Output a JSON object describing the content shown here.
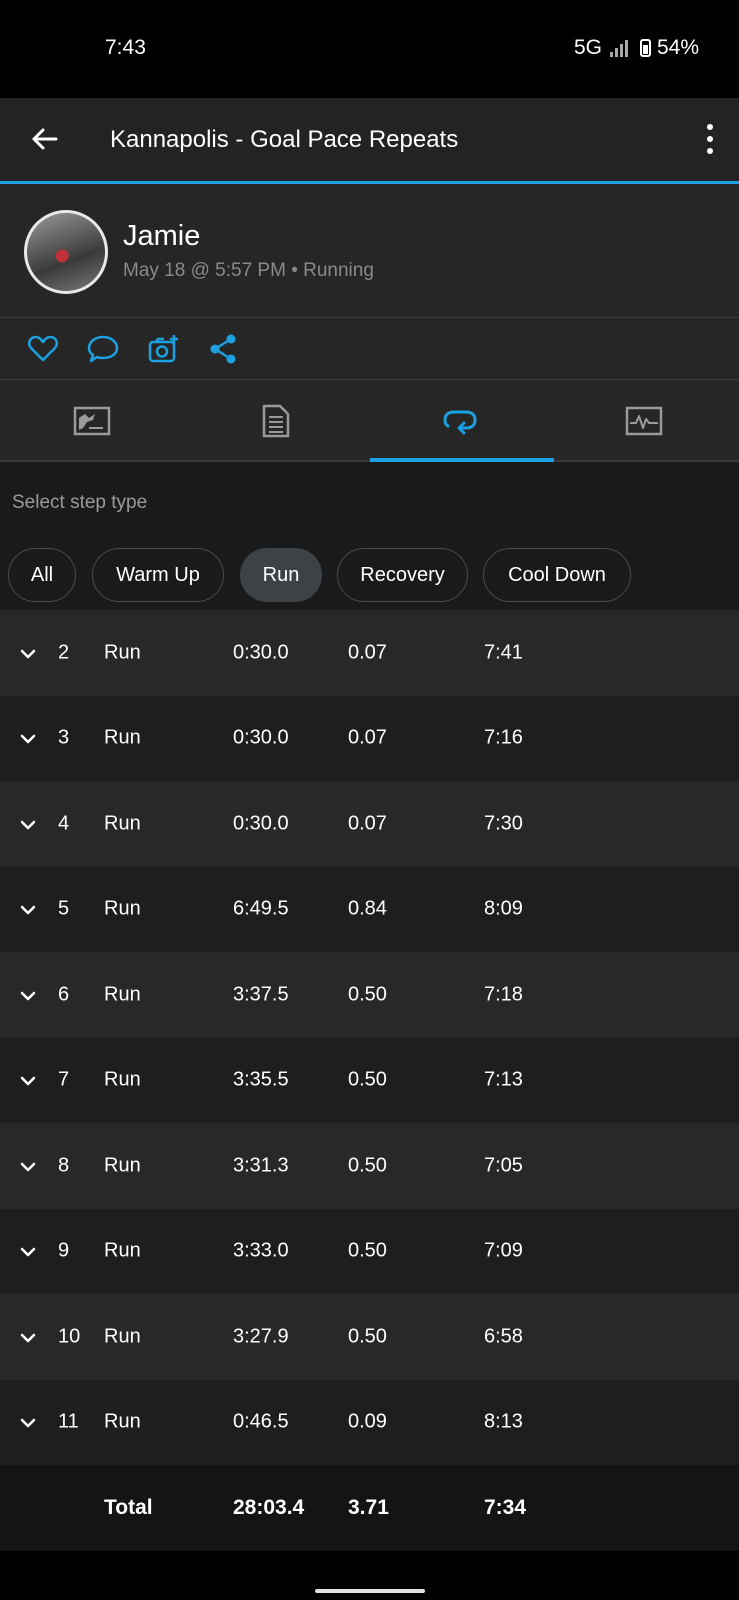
{
  "status_bar": {
    "time": "7:43",
    "network": "5G",
    "battery": "54%"
  },
  "header": {
    "title": "Kannapolis - Goal Pace Repeats"
  },
  "profile": {
    "name": "Jamie",
    "meta": "May 18 @ 5:57 PM • Running"
  },
  "filter": {
    "label": "Select step type",
    "chips": [
      {
        "label": "All",
        "active": false
      },
      {
        "label": "Warm Up",
        "active": false
      },
      {
        "label": "Run",
        "active": true
      },
      {
        "label": "Recovery",
        "active": false
      },
      {
        "label": "Cool Down",
        "active": false
      }
    ]
  },
  "tabs": [
    "overview-icon",
    "details-icon",
    "laps-icon",
    "charts-icon"
  ],
  "accent_color": "#1ba1e2",
  "steps": [
    {
      "num": "2",
      "type": "Run",
      "time": "0:30.0",
      "distance": "0.07",
      "pace": "7:41"
    },
    {
      "num": "3",
      "type": "Run",
      "time": "0:30.0",
      "distance": "0.07",
      "pace": "7:16"
    },
    {
      "num": "4",
      "type": "Run",
      "time": "0:30.0",
      "distance": "0.07",
      "pace": "7:30"
    },
    {
      "num": "5",
      "type": "Run",
      "time": "6:49.5",
      "distance": "0.84",
      "pace": "8:09"
    },
    {
      "num": "6",
      "type": "Run",
      "time": "3:37.5",
      "distance": "0.50",
      "pace": "7:18"
    },
    {
      "num": "7",
      "type": "Run",
      "time": "3:35.5",
      "distance": "0.50",
      "pace": "7:13"
    },
    {
      "num": "8",
      "type": "Run",
      "time": "3:31.3",
      "distance": "0.50",
      "pace": "7:05"
    },
    {
      "num": "9",
      "type": "Run",
      "time": "3:33.0",
      "distance": "0.50",
      "pace": "7:09"
    },
    {
      "num": "10",
      "type": "Run",
      "time": "3:27.9",
      "distance": "0.50",
      "pace": "6:58"
    },
    {
      "num": "11",
      "type": "Run",
      "time": "0:46.5",
      "distance": "0.09",
      "pace": "8:13"
    }
  ],
  "total": {
    "label": "Total",
    "time": "28:03.4",
    "distance": "3.71",
    "pace": "7:34"
  }
}
